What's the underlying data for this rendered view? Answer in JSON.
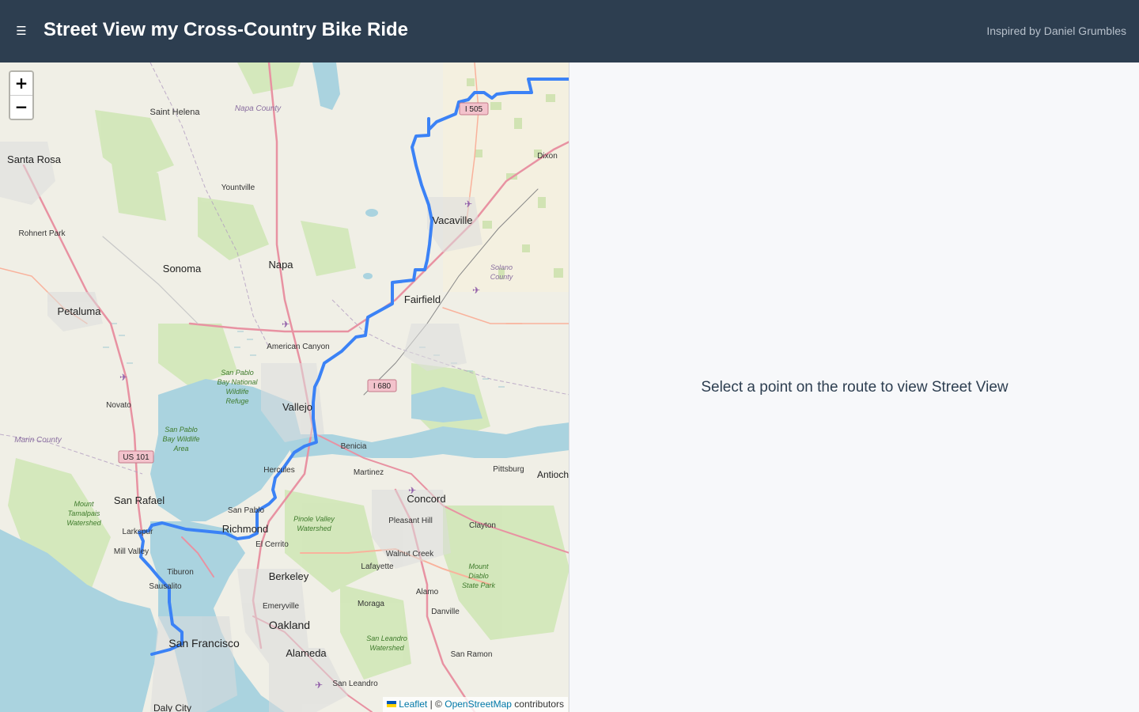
{
  "header": {
    "menu_icon": "menu-icon",
    "title": "Street View my Cross-Country Bike Ride",
    "credit": "Inspired by Daniel Grumbles",
    "background_color": "#2d3e50"
  },
  "map": {
    "zoom_in_label": "+",
    "zoom_out_label": "−",
    "route_color": "#3b82f6",
    "places": {
      "santa_rosa": "Santa Rosa",
      "saint_helena": "Saint Helena",
      "napa_county": "Napa County",
      "yountville": "Yountville",
      "rohnert_park": "Rohnert Park",
      "sonoma": "Sonoma",
      "napa": "Napa",
      "petaluma": "Petaluma",
      "american_canyon": "American Canyon",
      "san_pablo_refuge": "San Pablo Bay National Wildlife Refuge",
      "novato": "Novato",
      "marin_county": "Marin County",
      "san_pablo_bay_area": "San Pablo Bay Wildlife Area",
      "vallejo": "Vallejo",
      "benicia": "Benicia",
      "martinez": "Martinez",
      "hercules": "Hercules",
      "pittsburg": "Pittsburg",
      "antioch": "Antioch",
      "concord": "Concord",
      "san_rafael": "San Rafael",
      "mount_tamalpais": "Mount Tamalpais Watershed",
      "san_pablo": "San Pablo",
      "richmond": "Richmond",
      "pinole_valley": "Pinole Valley Watershed",
      "pleasant_hill": "Pleasant Hill",
      "clayton": "Clayton",
      "larkspur": "Larkspur",
      "mill_valley": "Mill Valley",
      "el_cerrito": "El Cerrito",
      "walnut_creek": "Walnut Creek",
      "tiburon": "Tiburon",
      "lafayette": "Lafayette",
      "mount_diablo": "Mount Diablo State Park",
      "sausalito": "Sausalito",
      "berkeley": "Berkeley",
      "alamo": "Alamo",
      "moraga": "Moraga",
      "danville": "Danville",
      "emeryville": "Emeryville",
      "oakland": "Oakland",
      "san_leandro_watershed": "San Leandro Watershed",
      "san_francisco": "San Francisco",
      "alameda": "Alameda",
      "san_ramon": "San Ramon",
      "san_leandro": "San Leandro",
      "daly_city": "Daly City",
      "dixon": "Dixon",
      "vacaville": "Vacaville",
      "solano_county": "Solano County",
      "fairfield": "Fairfield"
    },
    "shields": {
      "i505": "I 505",
      "i680": "I 680",
      "us101": "US 101"
    },
    "attribution": {
      "leaflet": "Leaflet",
      "separator": "| ©",
      "osm": "OpenStreetMap",
      "contributors": "contributors"
    }
  },
  "street_view": {
    "message": "Select a point on the route to view Street View"
  }
}
